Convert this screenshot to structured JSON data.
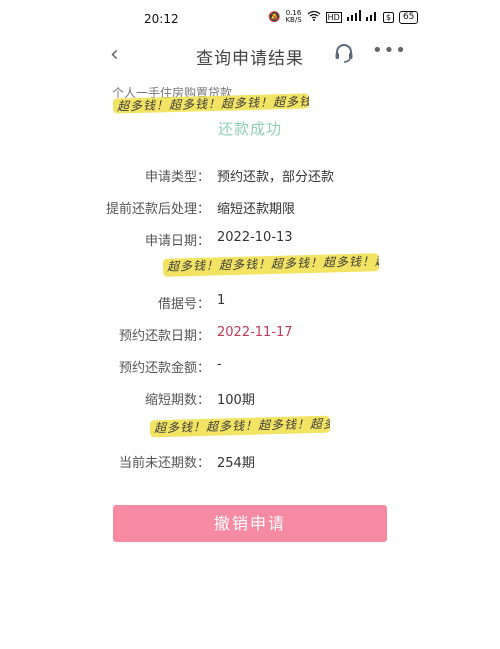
{
  "status_bar": {
    "time": "20:12",
    "net_speed": "0.16",
    "net_unit": "KB/S",
    "hd_label": "HD",
    "battery": "65"
  },
  "header": {
    "title": "查询申请结果",
    "back_icon": "chevron-left-icon",
    "support_icon": "headset-icon",
    "more_icon": "more-dots-icon"
  },
  "sub_title": "个人一手住房购置贷款",
  "watermark_text": "超多钱！超多钱！超多钱！超多钱！超多钱！",
  "result_status": "还款成功",
  "details": [
    {
      "label": "申请类型：",
      "value": "预约还款，部分还款"
    },
    {
      "label": "提前还款后处理：",
      "value": "缩短还款期限"
    },
    {
      "label": "申请日期：",
      "value": "2022-10-13"
    },
    {
      "label": "借据号：",
      "value": "1"
    },
    {
      "label": "预约还款日期：",
      "value": "2022-11-17"
    },
    {
      "label": "预约还款金额：",
      "value": "-"
    },
    {
      "label": "缩短期数：",
      "value": "100期"
    },
    {
      "label": "当前未还期数：",
      "value": "254期"
    }
  ],
  "cancel_button": "撤销申请",
  "colors": {
    "accent_green": "#8fd0b4",
    "date_red": "#c43a55",
    "button_pink": "#f78aa3",
    "highlight_yellow": "#f2e25a"
  }
}
